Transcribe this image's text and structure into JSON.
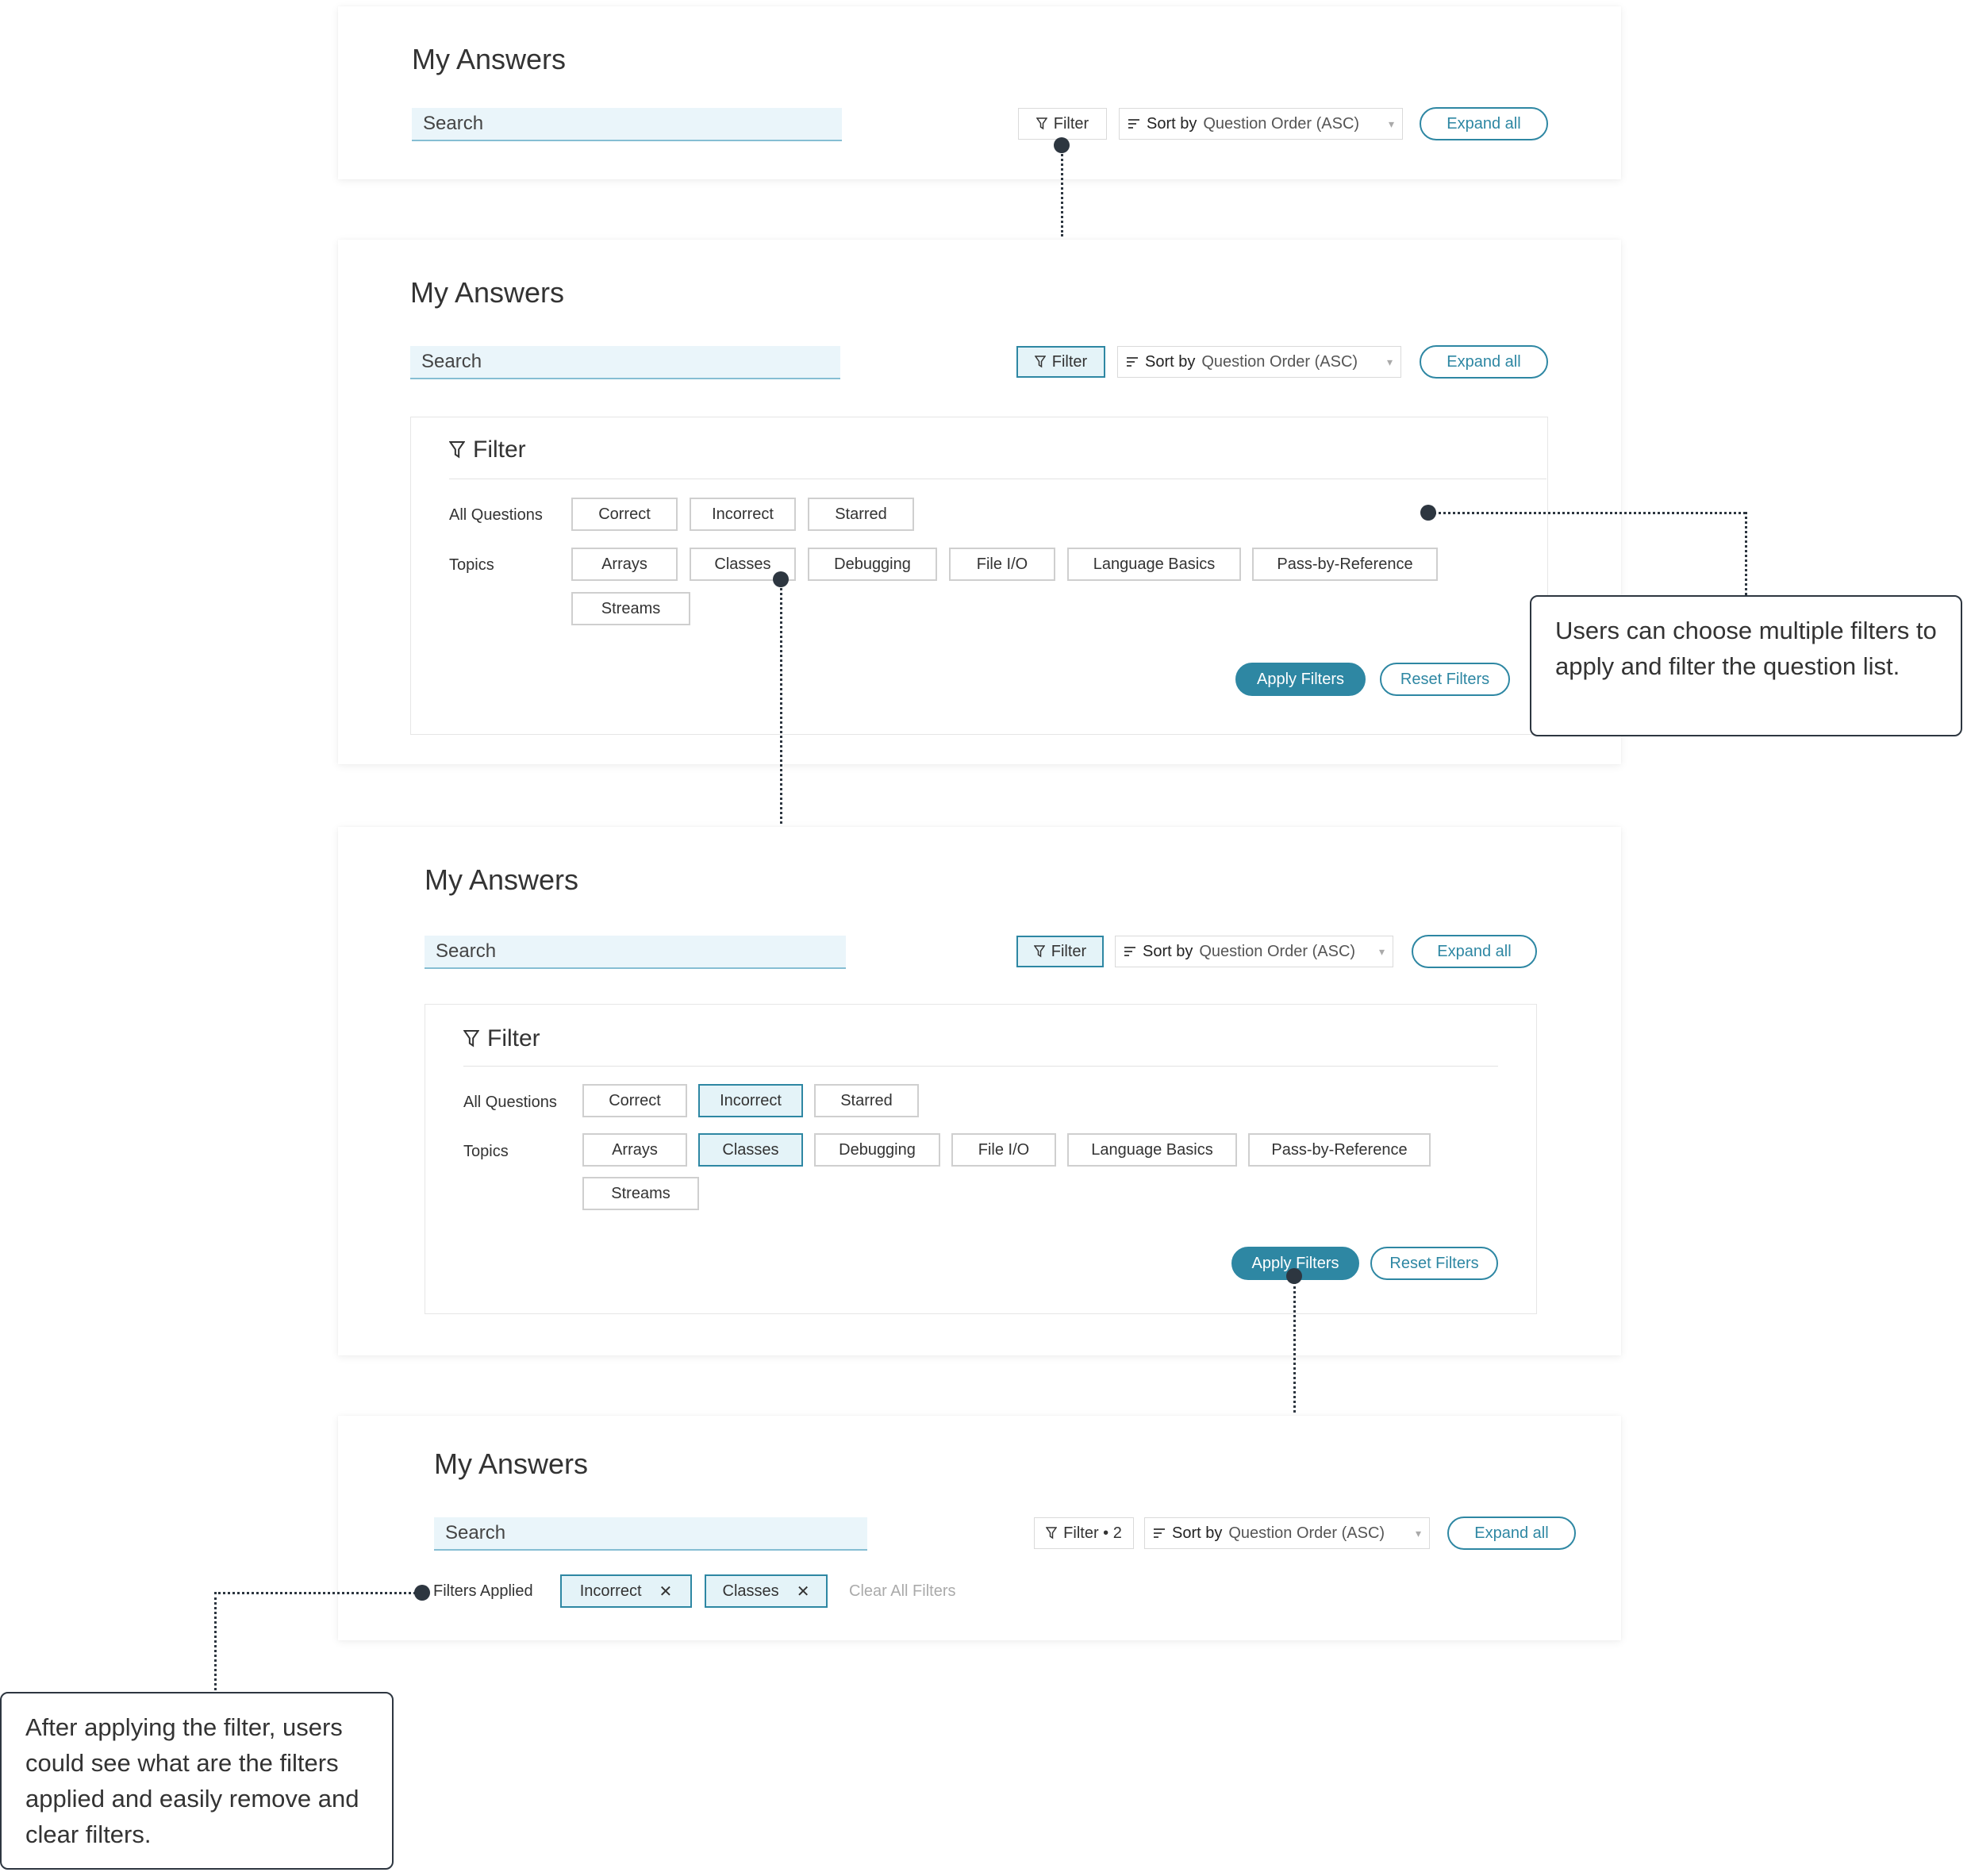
{
  "screens": [
    {
      "title": "My Answers",
      "search_placeholder": "Search",
      "filter_label": "Filter",
      "sort_label": "Sort by",
      "sort_value": "Question Order (ASC)",
      "expand_label": "Expand all"
    },
    {
      "title": "My Answers",
      "search_placeholder": "Search",
      "filter_label": "Filter",
      "sort_label": "Sort by",
      "sort_value": "Question Order (ASC)",
      "expand_label": "Expand all",
      "panel": {
        "title": "Filter",
        "all_questions_label": "All Questions",
        "topics_label": "Topics",
        "all_questions": [
          "Correct",
          "Incorrect",
          "Starred"
        ],
        "topics": [
          "Arrays",
          "Classes",
          "Debugging",
          "File I/O",
          "Language Basics",
          "Pass-by-Reference",
          "Streams"
        ],
        "apply_label": "Apply Filters",
        "reset_label": "Reset Filters"
      }
    },
    {
      "title": "My Answers",
      "search_placeholder": "Search",
      "filter_label": "Filter",
      "sort_label": "Sort by",
      "sort_value": "Question Order (ASC)",
      "expand_label": "Expand all",
      "panel": {
        "title": "Filter",
        "all_questions_label": "All Questions",
        "topics_label": "Topics",
        "all_questions": [
          "Correct",
          "Incorrect",
          "Starred"
        ],
        "topics": [
          "Arrays",
          "Classes",
          "Debugging",
          "File I/O",
          "Language Basics",
          "Pass-by-Reference",
          "Streams"
        ],
        "selected": [
          "Incorrect",
          "Classes"
        ],
        "apply_label": "Apply Filters",
        "reset_label": "Reset Filters"
      }
    },
    {
      "title": "My Answers",
      "search_placeholder": "Search",
      "filter_label": "Filter • 2",
      "sort_label": "Sort by",
      "sort_value": "Question Order (ASC)",
      "expand_label": "Expand all",
      "applied": {
        "label": "Filters Applied",
        "tags": [
          "Incorrect",
          "Classes"
        ],
        "clear_label": "Clear All Filters"
      }
    }
  ],
  "icons": {
    "filter": "funnel-icon",
    "sort": "sort-lines-icon",
    "caret": "caret-down-icon",
    "remove": "close-icon"
  },
  "annotations": {
    "multi_filter_note": "Users can choose multiple filters to apply and filter the question list.",
    "applied_note": "After applying the filter, users could see what are the filters applied and easily remove and clear filters."
  },
  "colors": {
    "accent": "#2e87a3",
    "search_bg": "#eaf5fa",
    "selected_bg": "#e4f3f8",
    "annotation": "#2d3640"
  }
}
